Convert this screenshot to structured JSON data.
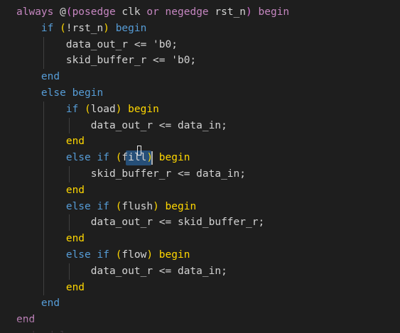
{
  "editor": {
    "language": "verilog",
    "selected_text": "fill",
    "lines": [
      {
        "tokens": [
          {
            "t": "always ",
            "c": "kw"
          },
          {
            "t": "@",
            "c": "punc"
          },
          {
            "t": "(",
            "c": "paren"
          },
          {
            "t": "posedge ",
            "c": "kw"
          },
          {
            "t": "clk ",
            "c": "id"
          },
          {
            "t": "or ",
            "c": "kw"
          },
          {
            "t": "negedge ",
            "c": "kw"
          },
          {
            "t": "rst_n",
            "c": "id"
          },
          {
            "t": ")",
            "c": "paren"
          },
          {
            "t": " begin",
            "c": "kw"
          }
        ]
      },
      {
        "tokens": [
          {
            "t": "    if ",
            "c": "ctrl"
          },
          {
            "t": "(",
            "c": "paren2"
          },
          {
            "t": "!rst_n",
            "c": "id"
          },
          {
            "t": ")",
            "c": "paren2"
          },
          {
            "t": " begin",
            "c": "ctrl"
          }
        ]
      },
      {
        "tokens": [
          {
            "t": "        data_out_r <= 'b0;",
            "c": "id"
          }
        ]
      },
      {
        "tokens": [
          {
            "t": "        skid_buffer_r <= 'b0;",
            "c": "id"
          }
        ]
      },
      {
        "tokens": [
          {
            "t": "    end",
            "c": "ctrl"
          }
        ]
      },
      {
        "tokens": [
          {
            "t": "    else begin",
            "c": "ctrl"
          }
        ]
      },
      {
        "tokens": [
          {
            "t": "        if ",
            "c": "ctrl"
          },
          {
            "t": "(",
            "c": "paren2"
          },
          {
            "t": "load",
            "c": "id"
          },
          {
            "t": ")",
            "c": "paren2"
          },
          {
            "t": " begin",
            "c": "ylw"
          }
        ]
      },
      {
        "tokens": [
          {
            "t": "            data_out_r <= data_in;",
            "c": "id"
          }
        ]
      },
      {
        "tokens": [
          {
            "t": "        end",
            "c": "ylw"
          }
        ]
      },
      {
        "tokens": [
          {
            "t": "        else if ",
            "c": "ctrl"
          },
          {
            "t": "(",
            "c": "paren2"
          },
          {
            "t": "fill",
            "c": "id"
          },
          {
            "t": ")",
            "c": "paren2"
          },
          {
            "t": " begin",
            "c": "ylw"
          }
        ]
      },
      {
        "tokens": [
          {
            "t": "            skid_buffer_r <= data_in;",
            "c": "id"
          }
        ]
      },
      {
        "tokens": [
          {
            "t": "        end",
            "c": "ylw"
          }
        ]
      },
      {
        "tokens": [
          {
            "t": "        else if ",
            "c": "ctrl"
          },
          {
            "t": "(",
            "c": "paren2"
          },
          {
            "t": "flush",
            "c": "id"
          },
          {
            "t": ")",
            "c": "paren2"
          },
          {
            "t": " begin",
            "c": "ylw"
          }
        ]
      },
      {
        "tokens": [
          {
            "t": "            data_out_r <= skid_buffer_r;",
            "c": "id"
          }
        ]
      },
      {
        "tokens": [
          {
            "t": "        end",
            "c": "ylw"
          }
        ]
      },
      {
        "tokens": [
          {
            "t": "        else if ",
            "c": "ctrl"
          },
          {
            "t": "(",
            "c": "paren2"
          },
          {
            "t": "flow",
            "c": "id"
          },
          {
            "t": ")",
            "c": "paren2"
          },
          {
            "t": " begin",
            "c": "ylw"
          }
        ]
      },
      {
        "tokens": [
          {
            "t": "            data_out_r <= data_in;",
            "c": "id"
          }
        ]
      },
      {
        "tokens": [
          {
            "t": "        end",
            "c": "ylw"
          }
        ]
      },
      {
        "tokens": [
          {
            "t": "    end",
            "c": "ctrl"
          }
        ]
      },
      {
        "tokens": [
          {
            "t": "end",
            "c": "kw"
          }
        ]
      },
      {
        "tokens": [
          {
            "t": "endmodule",
            "c": "kw"
          }
        ]
      }
    ]
  },
  "colors": {
    "background": "#1e1e1e",
    "keyword": "#c586c0",
    "control": "#569cd6",
    "identifier": "#d4d4d4",
    "bracket_yellow": "#ffd700",
    "bracket_magenta": "#da70d6",
    "selection": "#264f78",
    "indent_guide": "#404040"
  }
}
